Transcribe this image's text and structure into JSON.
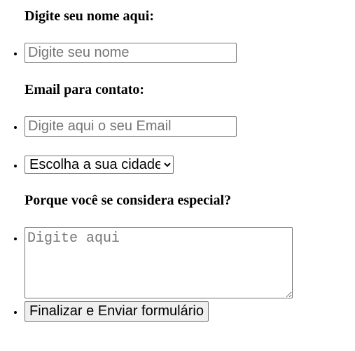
{
  "form": {
    "name_label": "Digite seu nome aqui:",
    "name_placeholder": "Digite seu nome",
    "email_label": "Email para contato:",
    "email_placeholder": "Digite aqui o seu Email",
    "city_select_value": "Escolha a sua cidade",
    "special_label": "Porque você se considera especial?",
    "special_placeholder": "Digite aqui",
    "submit_label": "Finalizar e Enviar formulário"
  }
}
